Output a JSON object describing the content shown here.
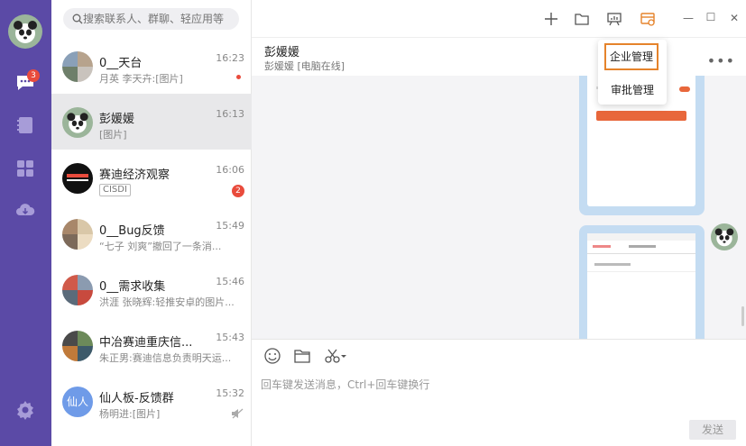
{
  "search": {
    "placeholder": "搜索联系人、群聊、轻应用等"
  },
  "rail": {
    "chat_badge": "3"
  },
  "conversations": [
    {
      "name": "0__天台",
      "time": "16:23",
      "preview": "月英 李天卉:[图片]",
      "unread_dot": true
    },
    {
      "name": "彭媛媛",
      "time": "16:13",
      "preview": "[图片]",
      "selected": true
    },
    {
      "name": "赛迪经济观察",
      "time": "16:06",
      "tag": "CISDI",
      "badge": "2"
    },
    {
      "name": "0__Bug反馈",
      "time": "15:49",
      "preview": "“七子 刘爽”撤回了一条消..."
    },
    {
      "name": "0__需求收集",
      "time": "15:46",
      "preview": "洪涯 张晓辉:轻推安卓的图片..."
    },
    {
      "name": "中冶赛迪重庆信...",
      "time": "15:43",
      "preview": "朱正男:赛迪信息负责明天运..."
    },
    {
      "name": "仙人板-反馈群",
      "time": "15:32",
      "preview": "杨明进:[图片]",
      "avatar_text": "仙人"
    }
  ],
  "chat": {
    "title": "彭媛媛",
    "subtitle": "彭媛媛 [电脑在线]",
    "more": "•••"
  },
  "dropdown": {
    "items": [
      "企业管理",
      "审批管理"
    ]
  },
  "composer": {
    "placeholder": "回车键发送消息，Ctrl+回车键换行",
    "send": "发送"
  },
  "window": {
    "minimize": "—",
    "maximize": "☐",
    "close": "✕"
  },
  "colors": {
    "rail": "#5b4aa6",
    "accent": "#e5832b",
    "badge": "#e94b3c"
  }
}
